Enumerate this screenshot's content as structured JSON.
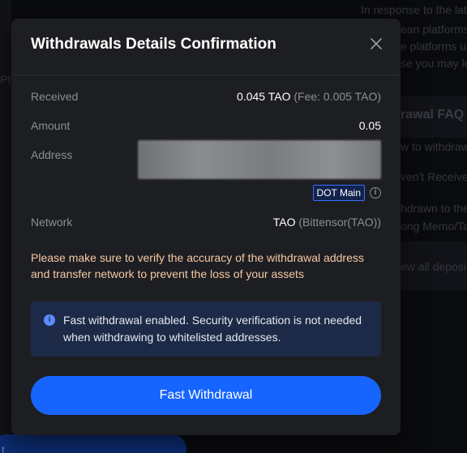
{
  "background": {
    "snippets": [
      "In response to the lat",
      "ean platforms",
      "e platforms ur",
      "se you may lo",
      "rawal FAQ",
      "w to withdraw",
      "ven't Receive",
      "hdrawn to the",
      "ong Memo/Ta",
      "ew all deposi"
    ],
    "left_snippet": "Pt",
    "bottom_button": "t"
  },
  "modal": {
    "title": "Withdrawals Details Confirmation",
    "close_icon": "close-icon",
    "rows": {
      "received": {
        "label": "Received",
        "value": "0.045 TAO",
        "fee": "(Fee: 0.005 TAO)"
      },
      "amount": {
        "label": "Amount",
        "value": "0.05"
      },
      "address": {
        "label": "Address",
        "tag": "DOT Main"
      },
      "network": {
        "label": "Network",
        "value": "TAO",
        "detail": "(Bittensor(TAO))"
      }
    },
    "warning": "Please make sure to verify the accuracy of the withdrawal address and transfer network to prevent the loss of your assets",
    "notice": "Fast withdrawal enabled. Security verification is not needed when withdrawing to whitelisted addresses.",
    "primary_button": "Fast Withdrawal"
  },
  "colors": {
    "accent": "#1765ff",
    "warning_text": "#f5c9a3",
    "notice_bg": "#1c2a47",
    "tag_border": "#3b6cff"
  }
}
